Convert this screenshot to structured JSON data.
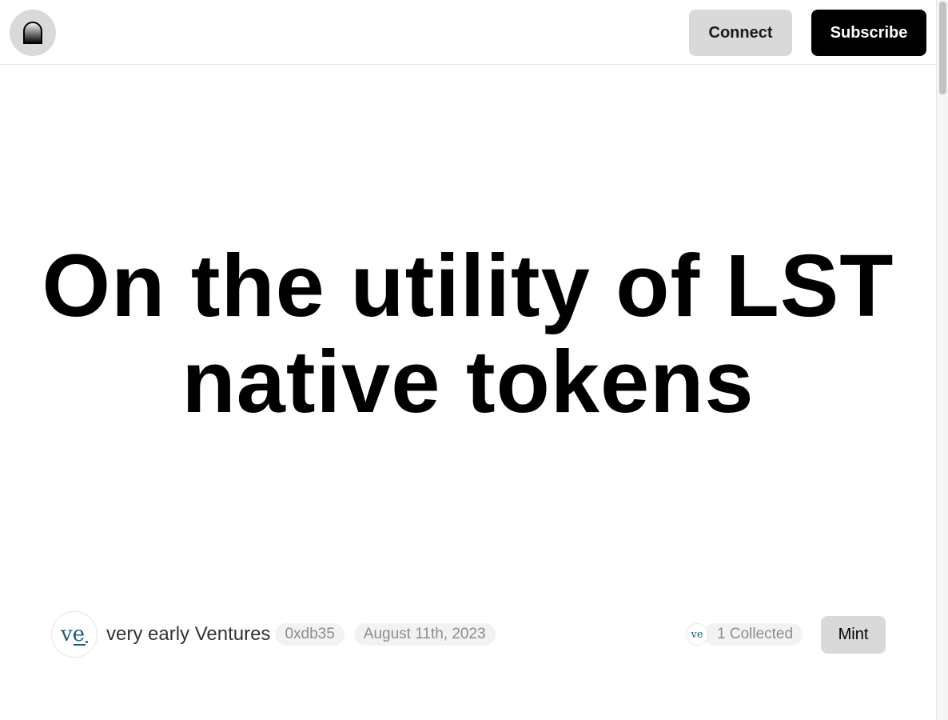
{
  "header": {
    "logo_icon": "arch-door-icon",
    "connect_label": "Connect",
    "subscribe_label": "Subscribe"
  },
  "article": {
    "title": "On the utility of LST native tokens",
    "author": {
      "name": "very early Ventures",
      "avatar_text_v": "v",
      "avatar_text_e": "e",
      "address": "0xdb35"
    },
    "date": "August 11th, 2023",
    "collect": {
      "collector_avatar_text": "ve",
      "collected_label": "1 Collected"
    },
    "mint_label": "Mint"
  },
  "colors": {
    "brand_text": "#1c5a7a",
    "button_gray": "#d9d9d9",
    "button_black": "#000000",
    "pill_bg": "#f2f2f2",
    "pill_text": "#8c8c8c"
  }
}
